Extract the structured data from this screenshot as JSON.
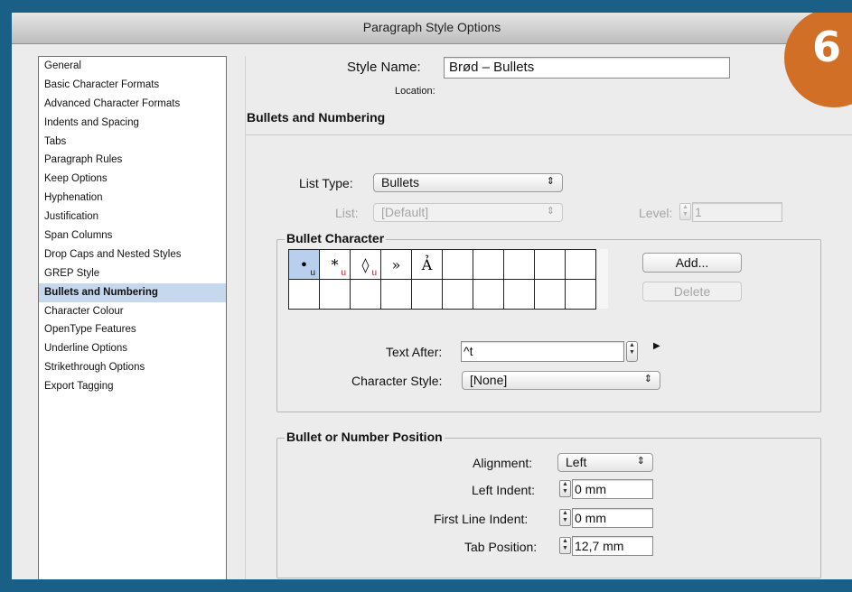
{
  "window": {
    "title": "Paragraph Style Options"
  },
  "badge": {
    "text": "6",
    "color": "#d16f27"
  },
  "sidebar": {
    "items": [
      "General",
      "Basic Character Formats",
      "Advanced Character Formats",
      "Indents and Spacing",
      "Tabs",
      "Paragraph Rules",
      "Keep Options",
      "Hyphenation",
      "Justification",
      "Span Columns",
      "Drop Caps and Nested Styles",
      "GREP Style",
      "Bullets and Numbering",
      "Character Colour",
      "OpenType Features",
      "Underline Options",
      "Strikethrough Options",
      "Export Tagging"
    ],
    "selected": "Bullets and Numbering"
  },
  "header": {
    "style_name_label": "Style Name:",
    "style_name_value": "Brød – Bullets",
    "location_label": "Location:",
    "section_title": "Bullets and Numbering"
  },
  "list": {
    "list_type_label": "List Type:",
    "list_type_value": "Bullets",
    "list_label": "List:",
    "list_value": "[Default]",
    "level_label": "Level:",
    "level_value": "1"
  },
  "bullet_character": {
    "group_title": "Bullet Character",
    "row1": [
      {
        "glyph": "•",
        "sub": "u",
        "sub_color": "black"
      },
      {
        "glyph": "*",
        "sub": "u",
        "sub_color": "red"
      },
      {
        "glyph": "◊",
        "sub": "u",
        "sub_color": "red"
      },
      {
        "glyph": "»",
        "sub": "",
        "sub_color": ""
      },
      {
        "glyph": "Ả",
        "sub": "",
        "sub_color": ""
      },
      {
        "glyph": "",
        "sub": "",
        "sub_color": ""
      },
      {
        "glyph": "",
        "sub": "",
        "sub_color": ""
      },
      {
        "glyph": "",
        "sub": "",
        "sub_color": ""
      },
      {
        "glyph": "",
        "sub": "",
        "sub_color": ""
      },
      {
        "glyph": "",
        "sub": "",
        "sub_color": ""
      }
    ],
    "add_button": "Add...",
    "delete_button": "Delete",
    "text_after_label": "Text After:",
    "text_after_value": "^t",
    "character_style_label": "Character Style:",
    "character_style_value": "[None]"
  },
  "position": {
    "group_title": "Bullet or Number Position",
    "alignment_label": "Alignment:",
    "alignment_value": "Left",
    "left_indent_label": "Left Indent:",
    "left_indent_value": "0 mm",
    "first_line_indent_label": "First Line Indent:",
    "first_line_indent_value": "0 mm",
    "tab_position_label": "Tab Position:",
    "tab_position_value": "12,7 mm"
  }
}
